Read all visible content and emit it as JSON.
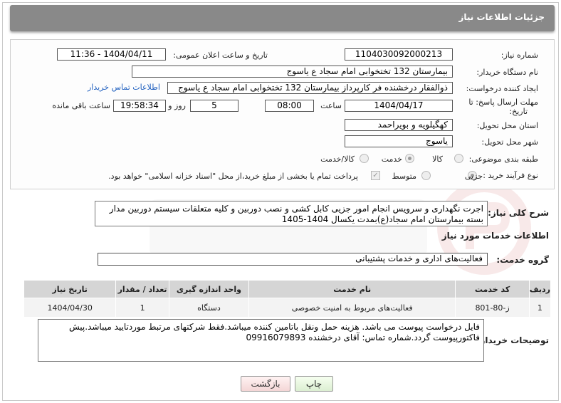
{
  "header": {
    "title": "جزئیات اطلاعات نیاز"
  },
  "need": {
    "number_label": "شماره نیاز:",
    "number": "1104030092000213",
    "announce_label": "تاریخ و ساعت اعلان عمومی:",
    "announce_value": "1404/04/11 - 11:36",
    "buyer_label": "نام دستگاه خریدار:",
    "buyer": "بیمارستان 132 تختخوابی امام سجاد  ع  یاسوج",
    "requester_label": "ایجاد کننده درخواست:",
    "requester": "ذوالفقار درخشنده فر کارپرداز بیمارستان 132 تختخوابی امام سجاد  ع  یاسوج",
    "contact_link": "اطلاعات تماس خریدار",
    "deadline_label_1": "مهلت ارسال پاسخ: تا",
    "deadline_label_2": "تاریخ:",
    "deadline_date": "1404/04/17",
    "time_label": "ساعت",
    "deadline_time": "08:00",
    "days_value": "5",
    "days_label": "روز و",
    "remaining_time": "19:58:34",
    "remaining_label": "ساعت باقی مانده",
    "province_label": "استان محل تحویل:",
    "province": "کهگیلویه و بویراحمد",
    "city_label": "شهر محل تحویل:",
    "city": "یاسوج",
    "category_label": "طبقه بندی موضوعی:",
    "category_options": [
      "کالا",
      "خدمت",
      "کالا/خدمت"
    ],
    "category_selected": "خدمت",
    "process_label": "نوع فرآیند خرید :",
    "process_options": [
      "جزیی",
      "متوسط"
    ],
    "payment_note": "پرداخت تمام یا بخشی از مبلغ خرید،از محل \"اسناد خزانه اسلامی\" خواهد بود."
  },
  "summary": {
    "label": "شرح کلی نیاز:",
    "text": "اجرت نگهداری و سرویس انجام امور جزیی کابل کشی و نصب دوربین و کلیه متعلقات سیستم دوربین مدار بسته بیمارستان امام سجاد(ع)بمدت یکسال 1404-1405"
  },
  "services": {
    "section_title": "اطلاعات خدمات مورد نیاز",
    "group_label": "گروه خدمت:",
    "group_value": "فعالیت‌های اداری و خدمات پشتیبانی",
    "columns": [
      "ردیف",
      "کد خدمت",
      "نام خدمت",
      "واحد اندازه گیری",
      "تعداد / مقدار",
      "تاریخ نیاز"
    ],
    "rows": [
      {
        "row": "1",
        "code": "ز-80-801",
        "name": "فعالیت‌های مربوط به امنیت خصوصی",
        "unit": "دستگاه",
        "qty": "1",
        "date": "1404/04/30"
      }
    ]
  },
  "buyer_notes": {
    "label": "توضیحات خریدار:",
    "text": "فایل درخواست پیوست می باشد. هزینه حمل ونقل باتامین کننده میباشد.فقط شرکتهای مرتبط موردتایید میباشد.پیش فاکتورپیوست گردد.شماره تماس: آقای درخشنده 09916079893"
  },
  "actions": {
    "print": "چاپ",
    "back": "بازگشت"
  },
  "colors": {
    "header": "#898989",
    "link": "#1f5fbf",
    "table_head": "#d5d5d5"
  }
}
